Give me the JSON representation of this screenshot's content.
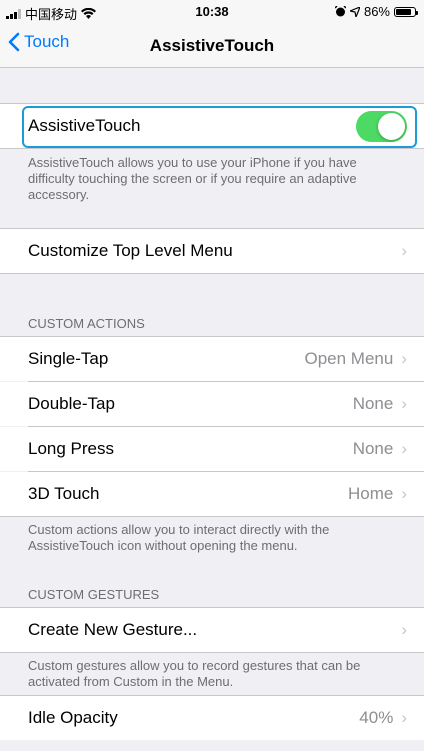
{
  "status_bar": {
    "carrier": "中国移动",
    "time": "10:38",
    "battery": "86%",
    "battery_level": 0.86
  },
  "nav": {
    "back_label": "Touch",
    "title": "AssistiveTouch"
  },
  "assistive": {
    "label": "AssistiveTouch",
    "toggle_on": true,
    "description": "AssistiveTouch allows you to use your iPhone if you have difficulty touching the screen or if you require an adaptive accessory."
  },
  "customize": {
    "label": "Customize Top Level Menu"
  },
  "custom_actions": {
    "header": "CUSTOM ACTIONS",
    "items": [
      {
        "label": "Single-Tap",
        "value": "Open Menu"
      },
      {
        "label": "Double-Tap",
        "value": "None"
      },
      {
        "label": "Long Press",
        "value": "None"
      },
      {
        "label": "3D Touch",
        "value": "Home"
      }
    ],
    "footer": "Custom actions allow you to interact directly with the AssistiveTouch icon without opening the menu."
  },
  "custom_gestures": {
    "header": "CUSTOM GESTURES",
    "create_label": "Create New Gesture...",
    "footer": "Custom gestures allow you to record gestures that can be activated from Custom in the Menu."
  },
  "idle_opacity": {
    "label": "Idle Opacity",
    "value": "40%"
  },
  "colors": {
    "accent": "#007aff",
    "toggle_on": "#4cd964",
    "highlight": "#1e9bd7"
  }
}
